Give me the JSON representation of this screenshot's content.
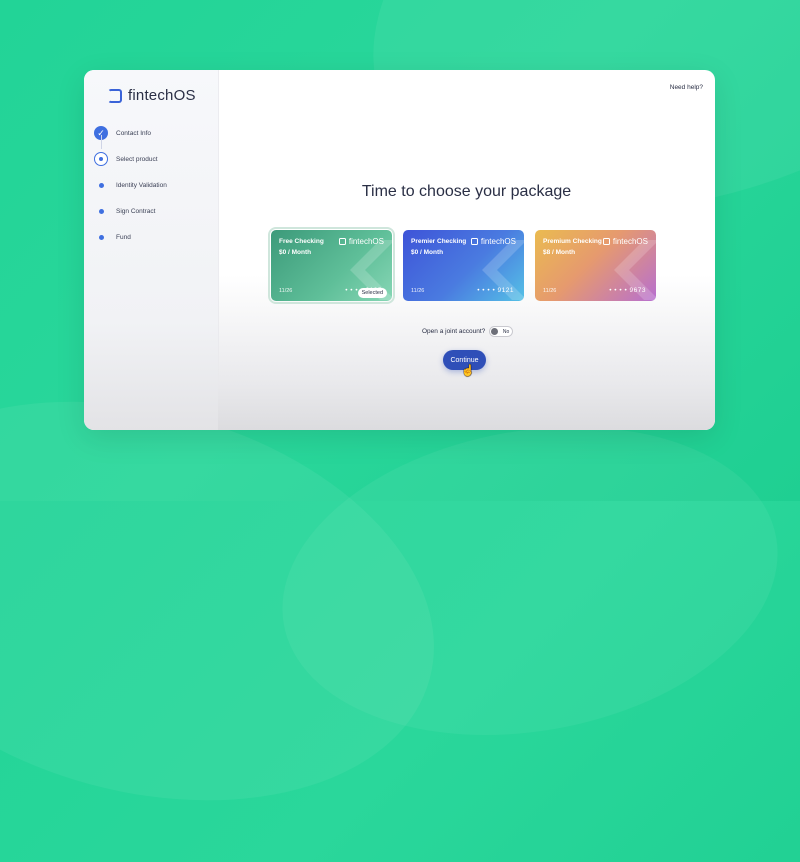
{
  "brand": {
    "name": "fintechOS"
  },
  "header": {
    "help_link": "Need help?"
  },
  "steps": [
    {
      "label": "Contact Info",
      "state": "done"
    },
    {
      "label": "Select product",
      "state": "current"
    },
    {
      "label": "Identity Validation",
      "state": "pending"
    },
    {
      "label": "Sign Contract",
      "state": "pending"
    },
    {
      "label": "Fund",
      "state": "pending"
    }
  ],
  "main": {
    "title": "Time to choose your package",
    "cards": [
      {
        "name": "Free Checking",
        "price": "$0 / Month",
        "expiry": "11/26",
        "number": "• • • • 2195",
        "brand": "fintechOS",
        "selected_label": "Selected"
      },
      {
        "name": "Premier Checking",
        "price": "$0 / Month",
        "expiry": "11/26",
        "number": "• • • • 9121",
        "brand": "fintechOS"
      },
      {
        "name": "Premium Checking",
        "price": "$8 / Month",
        "expiry": "11/26",
        "number": "• • • • 9673",
        "brand": "fintechOS"
      }
    ],
    "joint_account": {
      "label": "Open a joint account?",
      "toggle_value": "No"
    },
    "continue_label": "Continue"
  },
  "colors": {
    "accent": "#2f4fb8",
    "background": "#22d497"
  }
}
